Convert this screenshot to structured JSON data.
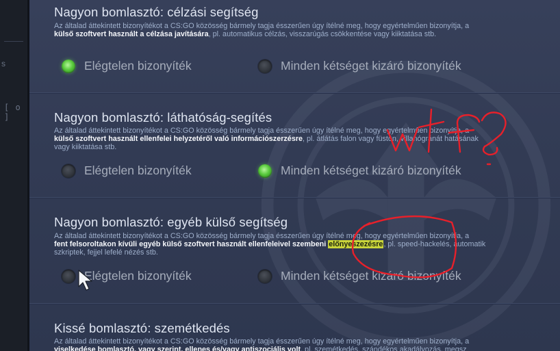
{
  "left_strip": {
    "fragment_top": "s",
    "fragment_mid": "[ o ]"
  },
  "sections": [
    {
      "title": "Nagyon bomlasztó: célzási segítség",
      "desc_line1": "Az általad áttekintett bizonyítékot a CS:GO közösség bármely tagja ésszerűen úgy ítélné meg, hogy egyértelműen bizonyítja, a",
      "desc_bold": "külső szoftvert használt a célzása javítására",
      "desc_rest": ", pl. automatikus célzás, visszarúgás csökkentése vagy kiiktatása stb.",
      "desc_line3": ""
    },
    {
      "title": "Nagyon bomlasztó: láthatóság-segítés",
      "desc_line1": "Az általad áttekintett bizonyítékot a CS:GO közösség bármely tagja ésszerűen úgy ítélné meg, hogy egyértelműen bizonyítja, a",
      "desc_bold": "külső szoftvert használt ellenfelei helyzetéről való információszerzésre",
      "desc_rest": ", pl. átlátás falon vagy füstön, villanógránát hatásának",
      "desc_line3": "vagy kiiktatása stb."
    },
    {
      "title": "Nagyon bomlasztó: egyéb külső segítség",
      "desc_line1": "Az általad áttekintett bizonyítékot a CS:GO közösség bármely tagja ésszerűen úgy ítélné meg, hogy egyértelműen bizonyítja, a",
      "desc_bold": "fent felsoroltakon kívüli egyéb külső szoftvert használt ellenfeleivel szembeni",
      "desc_highlight": "előnyeszezésre",
      "desc_rest": ", pl. speed-hackelés, automatik",
      "desc_line3": "szkriptek, fejjel lefelé nézés stb."
    },
    {
      "title": "Kissé bomlasztó: szemétkedés",
      "desc_line1": "Az általad áttekintett bizonyítékot a CS:GO közösség bármely tagja ésszerűen úgy ítélné meg, hogy egyértelműen bizonyítja, a",
      "desc_bold": "viselkedése bomlasztó, vagy szerint, ellenes és/vagy antiszociális volt",
      "desc_rest": ", pl. szemétkedés, szándékos akadályozás, megsz"
    }
  ],
  "options": {
    "insufficient": "Elégtelen bizonyíték",
    "beyond_doubt": "Minden kétséget kizáró bizonyíték"
  },
  "selected": [
    "insufficient",
    "beyond_doubt",
    "none"
  ],
  "annotation": {
    "text": "wtf?",
    "color": "#e8202a"
  },
  "colors": {
    "selected_green": "#57c93b",
    "highlight": "#c9d43a"
  }
}
